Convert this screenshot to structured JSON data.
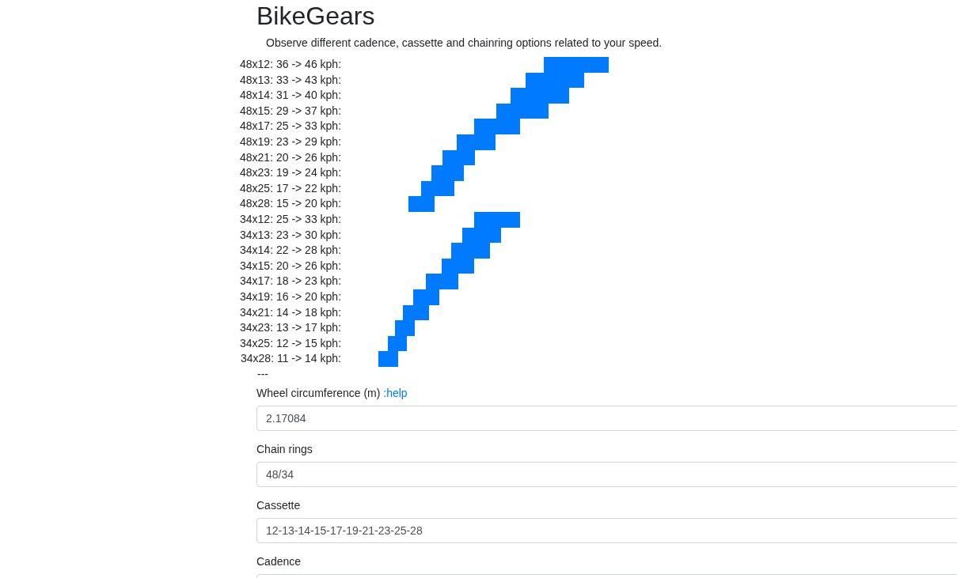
{
  "title": "BikeGears",
  "subtitle": "Observe different cadence, cassette and chainring options related to your speed.",
  "gears": [
    {
      "label": "48x12: 36 -> 46 kph:"
    },
    {
      "label": "48x13: 33 -> 43 kph:"
    },
    {
      "label": "48x14: 31 -> 40 kph:"
    },
    {
      "label": "48x15: 29 -> 37 kph:"
    },
    {
      "label": "48x17: 25 -> 33 kph:"
    },
    {
      "label": "48x19: 23 -> 29 kph:"
    },
    {
      "label": "48x21: 20 -> 26 kph:"
    },
    {
      "label": "48x23: 19 -> 24 kph:"
    },
    {
      "label": "48x25: 17 -> 22 kph:"
    },
    {
      "label": "48x28: 15 -> 20 kph:"
    },
    {
      "label": "34x12: 25 -> 33 kph:"
    },
    {
      "label": "34x13: 23 -> 30 kph:"
    },
    {
      "label": "34x14: 22 -> 28 kph:"
    },
    {
      "label": "34x15: 20 -> 26 kph:"
    },
    {
      "label": "34x17: 18 -> 23 kph:"
    },
    {
      "label": "34x19: 16 -> 20 kph:"
    },
    {
      "label": "34x21: 14 -> 18 kph:"
    },
    {
      "label": "34x23: 13 -> 17 kph:"
    },
    {
      "label": "34x25: 12 -> 15 kph:"
    },
    {
      "label": "34x28: 11 -> 14 kph:"
    }
  ],
  "separator": "---",
  "fields": [
    {
      "label": "Wheel circumference (m)",
      "link": ":help",
      "value": "2.17084"
    },
    {
      "label": "Chain rings",
      "value": "48/34"
    },
    {
      "label": "Cassette",
      "value": "12-13-14-15-17-19-21-23-25-28"
    },
    {
      "label": "Cadence"
    }
  ]
}
